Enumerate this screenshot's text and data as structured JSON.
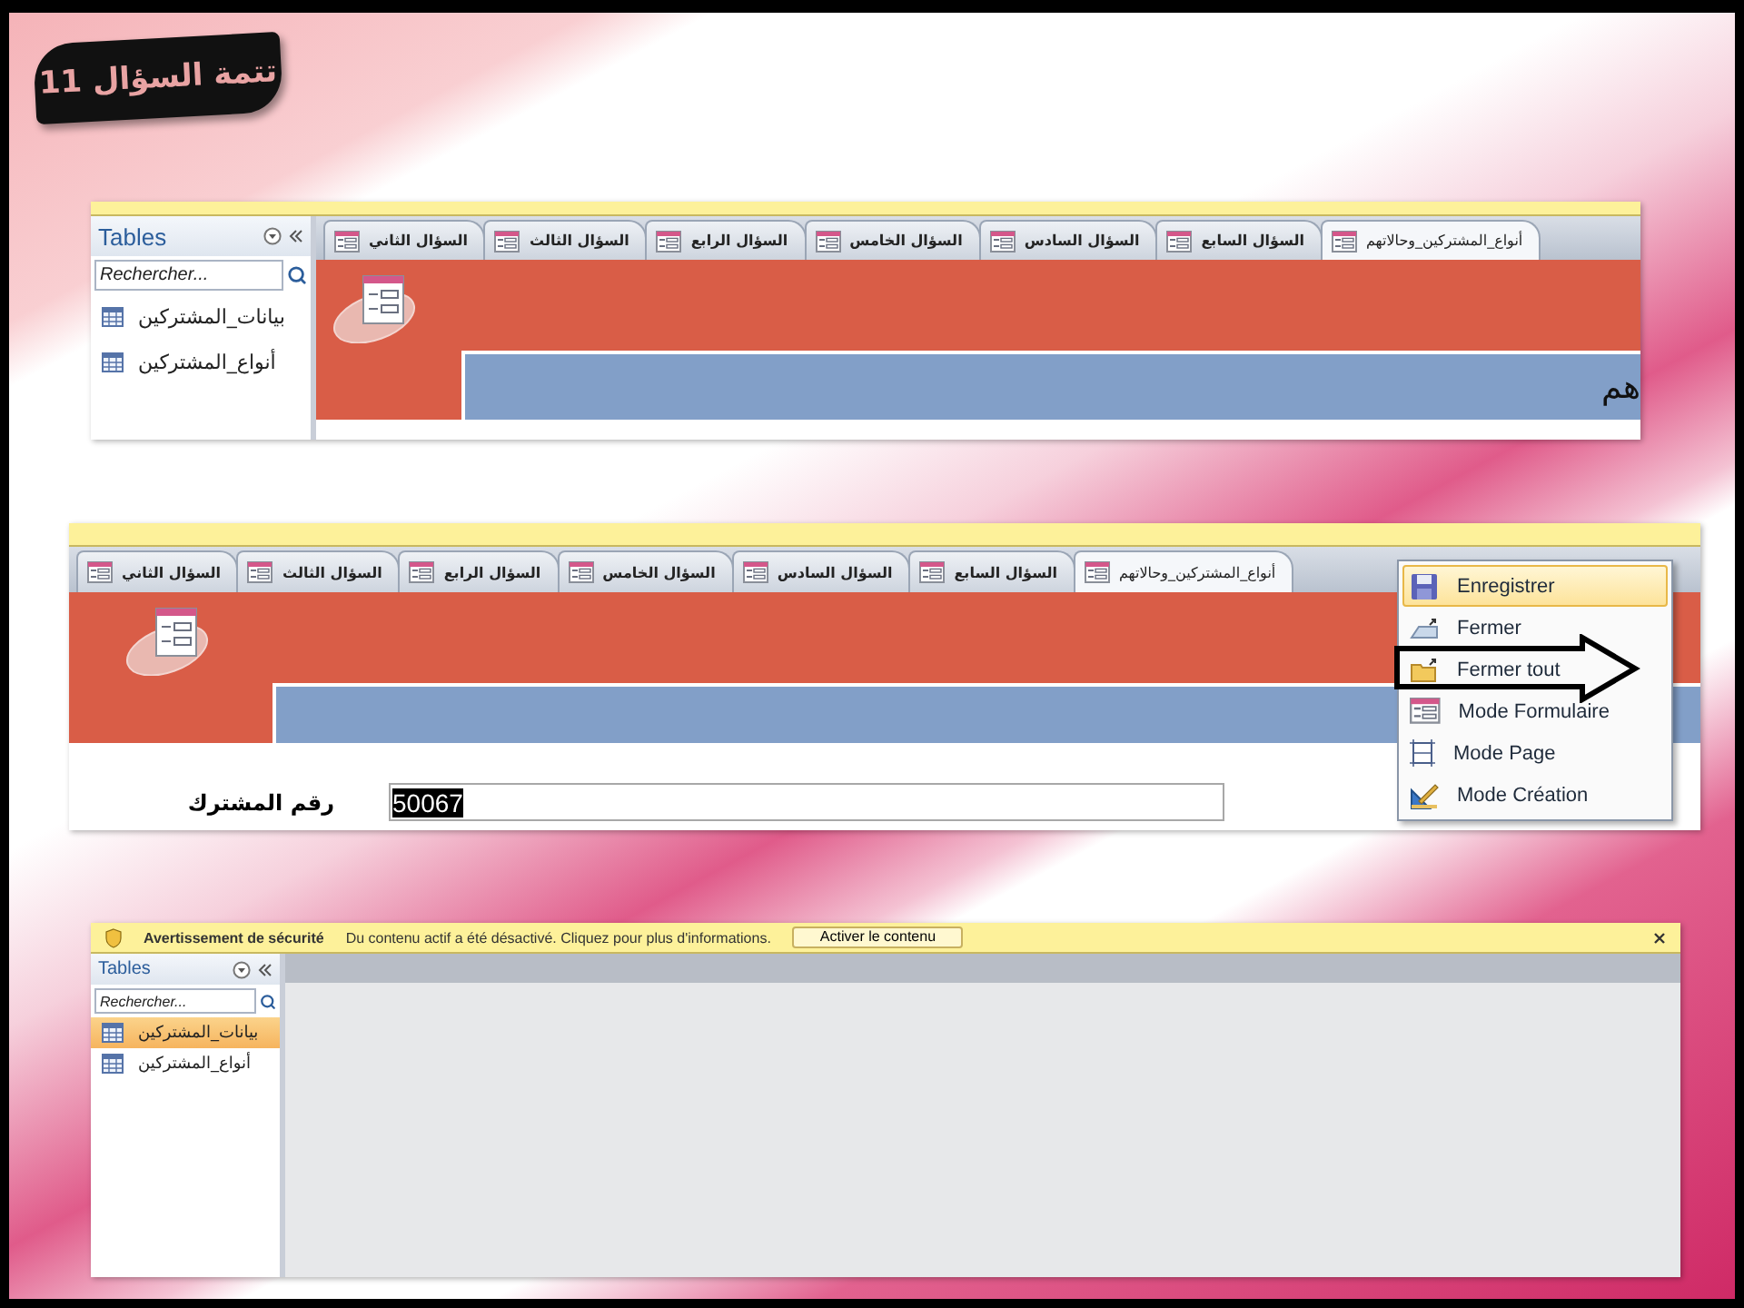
{
  "banner": {
    "title": "تتمة السؤال 11"
  },
  "screen_1": {
    "nav": {
      "title": "Tables",
      "search": {
        "placeholder": "Rechercher..."
      },
      "items": [
        {
          "label": "بيانات_المشتركين",
          "selected": false
        },
        {
          "label": "أنواع_المشتركين",
          "selected": false
        }
      ]
    },
    "tabs": [
      {
        "label": "أنواع_المشتركين_وحالاتهم",
        "selected": true
      },
      {
        "label": "السؤال السابع",
        "selected": false
      },
      {
        "label": "السؤال السادس",
        "selected": false
      },
      {
        "label": "السؤال الخامس",
        "selected": false
      },
      {
        "label": "السؤال الرابع",
        "selected": false
      },
      {
        "label": "السؤال الثالث",
        "selected": false
      },
      {
        "label": "السؤال الثاني",
        "selected": false
      }
    ],
    "band_text": "هم"
  },
  "screen_2": {
    "tabs": [
      {
        "label": "أنواع_المشتركين_وحالاتهم",
        "selected": true
      },
      {
        "label": "السؤال السابع",
        "selected": false
      },
      {
        "label": "السؤال السادس",
        "selected": false
      },
      {
        "label": "السؤال الخامس",
        "selected": false
      },
      {
        "label": "السؤال الرابع",
        "selected": false
      },
      {
        "label": "السؤال الثالث",
        "selected": false
      },
      {
        "label": "السؤال الثاني",
        "selected": false
      }
    ],
    "field": {
      "label": "رقم المشترك",
      "value": "50067",
      "value_selected": true
    },
    "menu": [
      {
        "kind": "save",
        "label": "Enregistrer",
        "selected": true
      },
      {
        "kind": "close",
        "label": "Fermer",
        "selected": false
      },
      {
        "kind": "close-all",
        "label": "Fermer tout",
        "selected": false
      },
      {
        "kind": "form",
        "label": "Mode Formulaire",
        "selected": false
      },
      {
        "kind": "layout",
        "label": "Mode Page",
        "selected": false
      },
      {
        "kind": "design",
        "label": "Mode Création",
        "selected": false
      }
    ]
  },
  "screen_3": {
    "security_bar": {
      "title": "Avertissement de sécurité",
      "message": "Du contenu actif a été désactivé. Cliquez pour plus d'informations.",
      "button": "Activer le contenu"
    },
    "nav": {
      "title": "Tables",
      "search": {
        "placeholder": "Rechercher..."
      },
      "items": [
        {
          "label": "بيانات_المشتركين",
          "selected": true
        },
        {
          "label": "أنواع_المشتركين",
          "selected": false
        }
      ]
    }
  }
}
